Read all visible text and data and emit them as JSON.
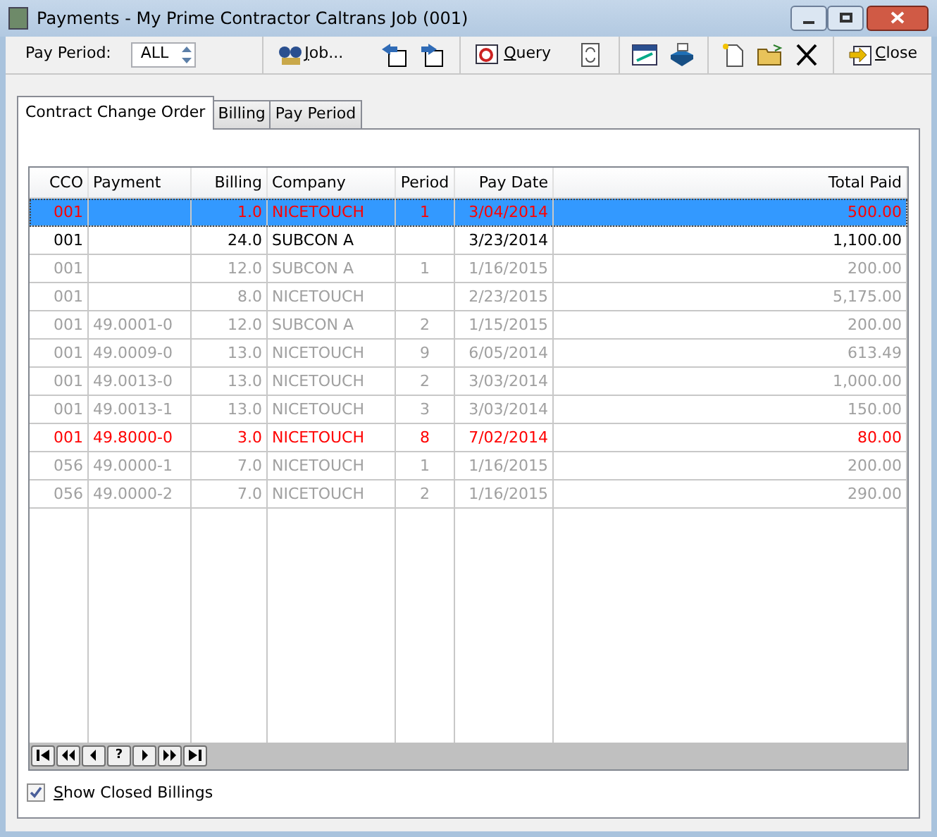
{
  "window": {
    "title": "Payments - My Prime Contractor Caltrans Job (001)"
  },
  "toolbar": {
    "pay_period_label": "Pay Period:",
    "pay_period_value": "ALL",
    "job_button": "Job...",
    "query_button": "Query",
    "close_button": "Close"
  },
  "tabs": [
    {
      "label": "Contract Change Order",
      "selected": true
    },
    {
      "label": "Billing",
      "selected": false
    },
    {
      "label": "Pay Period",
      "selected": false
    }
  ],
  "table": {
    "columns": [
      "CCO",
      "Payment",
      "Billing",
      "Company",
      "Period",
      "Pay Date",
      "Total Paid"
    ],
    "rows": [
      {
        "kind": "alert",
        "selected": true,
        "cells": [
          "001",
          "",
          "1.0",
          "NICETOUCH",
          "1",
          "3/04/2014",
          "500.00"
        ]
      },
      {
        "kind": "active",
        "selected": false,
        "cells": [
          "001",
          "",
          "24.0",
          "SUBCON A",
          "",
          "3/23/2014",
          "1,100.00"
        ]
      },
      {
        "kind": "closed",
        "selected": false,
        "cells": [
          "001",
          "",
          "12.0",
          "SUBCON A",
          "1",
          "1/16/2015",
          "200.00"
        ]
      },
      {
        "kind": "closed",
        "selected": false,
        "cells": [
          "001",
          "",
          "8.0",
          "NICETOUCH",
          "",
          "2/23/2015",
          "5,175.00"
        ]
      },
      {
        "kind": "closed",
        "selected": false,
        "cells": [
          "001",
          "49.0001-0",
          "12.0",
          "SUBCON A",
          "2",
          "1/15/2015",
          "200.00"
        ]
      },
      {
        "kind": "closed",
        "selected": false,
        "cells": [
          "001",
          "49.0009-0",
          "13.0",
          "NICETOUCH",
          "9",
          "6/05/2014",
          "613.49"
        ]
      },
      {
        "kind": "closed",
        "selected": false,
        "cells": [
          "001",
          "49.0013-0",
          "13.0",
          "NICETOUCH",
          "2",
          "3/03/2014",
          "1,000.00"
        ]
      },
      {
        "kind": "closed",
        "selected": false,
        "cells": [
          "001",
          "49.0013-1",
          "13.0",
          "NICETOUCH",
          "3",
          "3/03/2014",
          "150.00"
        ]
      },
      {
        "kind": "alert",
        "selected": false,
        "cells": [
          "001",
          "49.8000-0",
          "3.0",
          "NICETOUCH",
          "8",
          "7/02/2014",
          "80.00"
        ]
      },
      {
        "kind": "closed",
        "selected": false,
        "cells": [
          "056",
          "49.0000-1",
          "7.0",
          "NICETOUCH",
          "1",
          "1/16/2015",
          "200.00"
        ]
      },
      {
        "kind": "closed",
        "selected": false,
        "cells": [
          "056",
          "49.0000-2",
          "7.0",
          "NICETOUCH",
          "2",
          "1/16/2015",
          "290.00"
        ]
      }
    ]
  },
  "navigator": {
    "help_button": "?"
  },
  "show_closed": {
    "label": "Show Closed Billings",
    "checked": true
  }
}
